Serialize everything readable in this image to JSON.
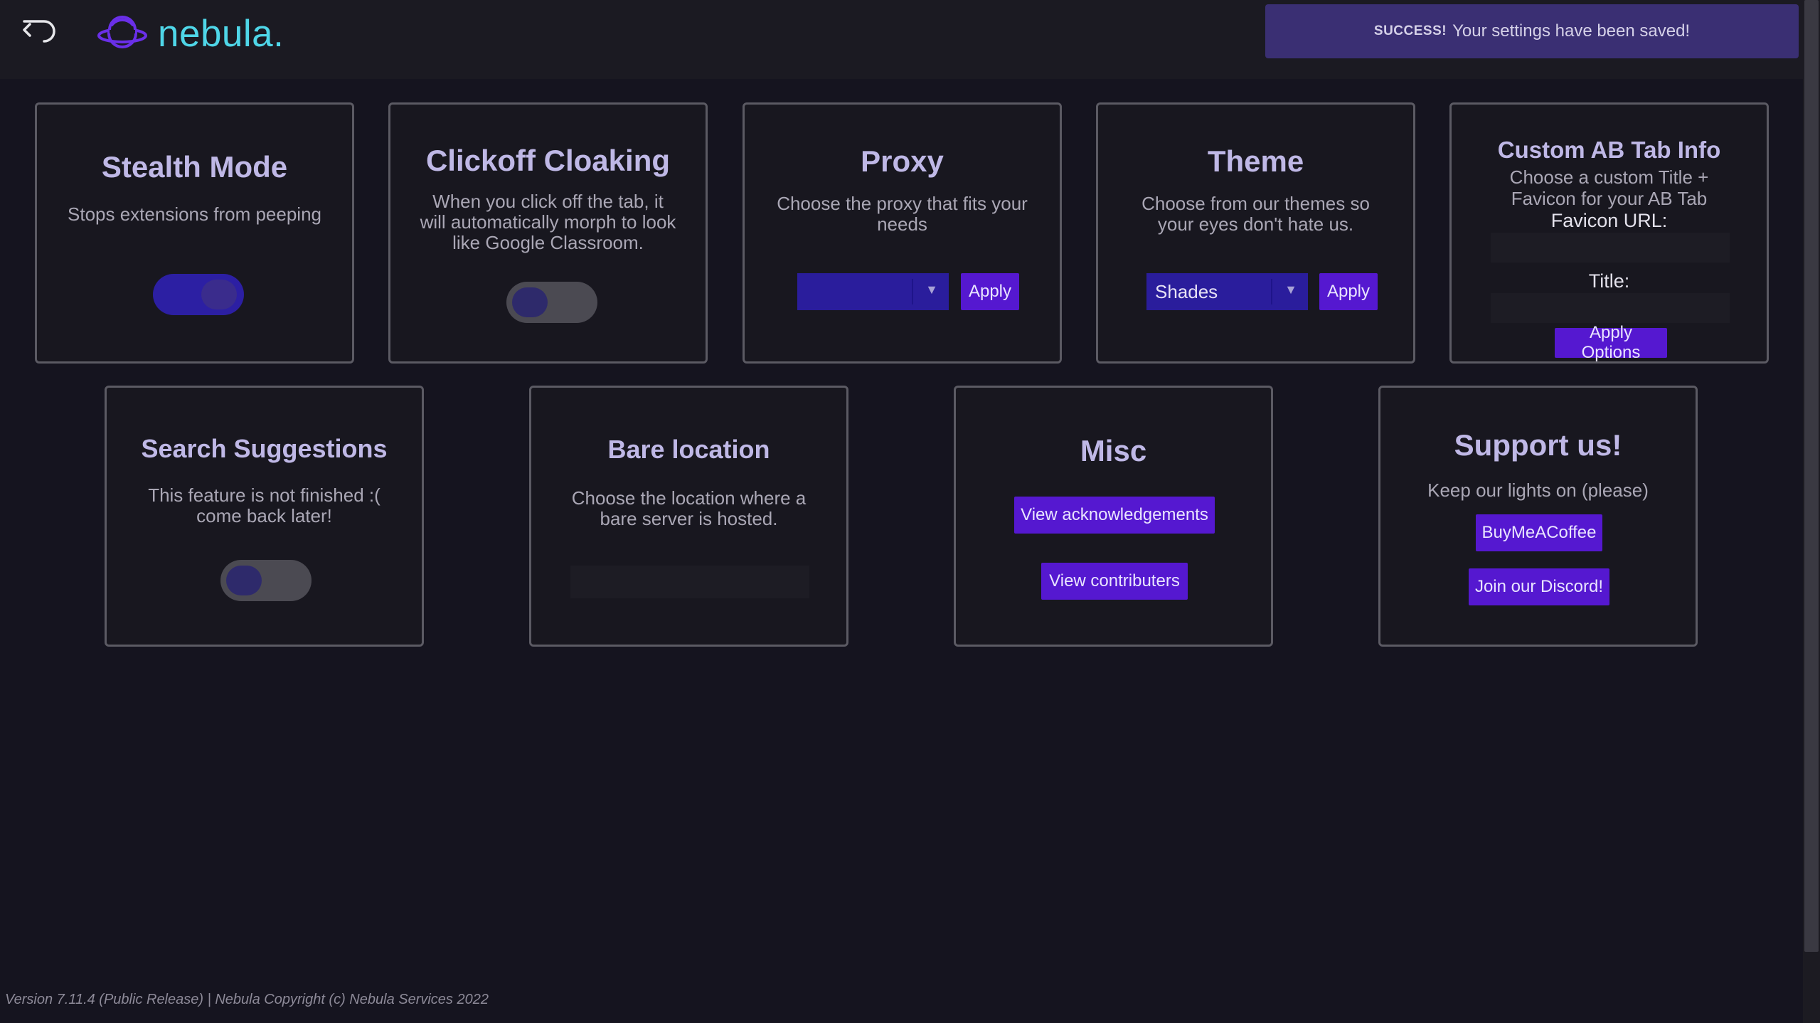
{
  "app": {
    "logo_text": "nebula.",
    "back_icon": "back-arrow-icon",
    "logo_icon": "planet-icon"
  },
  "toast": {
    "strong": "SUCCESS!",
    "message": "Your settings have been saved!"
  },
  "cards": {
    "stealth": {
      "title": "Stealth Mode",
      "desc": "Stops extensions from peeping",
      "toggle_state": "on"
    },
    "clickoff": {
      "title": "Clickoff Cloaking",
      "desc_lines": [
        "When you click off the tab, it",
        "will automatically morph to look",
        "like Google Classroom."
      ],
      "toggle_state": "off"
    },
    "proxy": {
      "title": "Proxy",
      "desc_lines": [
        "Choose the proxy that fits your",
        "needs"
      ],
      "select_value": "",
      "apply_label": "Apply"
    },
    "theme": {
      "title": "Theme",
      "desc_lines": [
        "Choose from our themes so",
        "your eyes don't hate us."
      ],
      "select_value": "Shades",
      "apply_label": "Apply"
    },
    "custom_ab": {
      "title": "Custom AB Tab Info",
      "desc_lines": [
        "Choose a custom Title +",
        "Favicon for your AB Tab"
      ],
      "favicon_label": "Favicon URL:",
      "favicon_value": "",
      "title_label": "Title:",
      "title_value": "",
      "apply_label": "Apply Options"
    },
    "search": {
      "title": "Search Suggestions",
      "desc_lines": [
        "This feature is not finished :(",
        "come back later!"
      ],
      "toggle_state": "off"
    },
    "bare": {
      "title": "Bare location",
      "desc_lines": [
        "Choose the location where a",
        "bare server is hosted."
      ],
      "input_value": ""
    },
    "misc": {
      "title": "Misc",
      "ack_label": "View acknowledgements",
      "contrib_label": "View contributers"
    },
    "support": {
      "title": "Support us!",
      "desc": "Keep our lights on (please)",
      "coffee_label": "BuyMeACoffee",
      "discord_label": "Join our Discord!"
    }
  },
  "footer": {
    "text": "Version 7.11.4 (Public Release) | Nebula Copyright (c) Nebula Services 2022"
  },
  "colors": {
    "background": "#15141f",
    "accent": "#5518d0",
    "title": "#bfb8e6",
    "logo": "#4fd6e8"
  }
}
